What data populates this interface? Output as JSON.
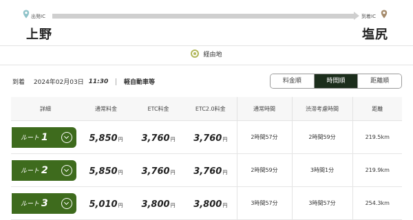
{
  "route": {
    "start_label": "出発IC",
    "end_label": "到着IC",
    "start_city": "上野",
    "end_city": "塩尻"
  },
  "via": {
    "label": "経由地"
  },
  "conditions": {
    "mode": "到着",
    "date": "2024年02月03日",
    "time": "11:30",
    "vehicle": "軽自動車等"
  },
  "sort_tabs": [
    {
      "label": "料金順",
      "active": false
    },
    {
      "label": "時間順",
      "active": true
    },
    {
      "label": "距離順",
      "active": false
    }
  ],
  "table": {
    "headers": [
      "詳細",
      "通常料金",
      "ETC料金",
      "ETC2.0料金",
      "通常時間",
      "渋滞考慮時間",
      "距離"
    ],
    "route_prefix": "ルート",
    "currency": "円",
    "rows": [
      {
        "num": "1",
        "normal": "5,850",
        "etc": "3,760",
        "etc2": "3,760",
        "time": "2時間57分",
        "jam_time": "2時間59分",
        "distance": "219.5km"
      },
      {
        "num": "2",
        "normal": "5,850",
        "etc": "3,760",
        "etc2": "3,760",
        "time": "2時間59分",
        "jam_time": "3時間1分",
        "distance": "219.9km"
      },
      {
        "num": "3",
        "normal": "5,010",
        "etc": "3,800",
        "etc2": "3,800",
        "time": "3時間57分",
        "jam_time": "3時間57分",
        "distance": "254.3km"
      }
    ]
  },
  "colors": {
    "accent_green": "#3e6b1d",
    "active_tab": "#1c2e1c",
    "pin_start": "#8fc3c9",
    "pin_end": "#a58b6c",
    "via_icon": "#b1b75a"
  }
}
